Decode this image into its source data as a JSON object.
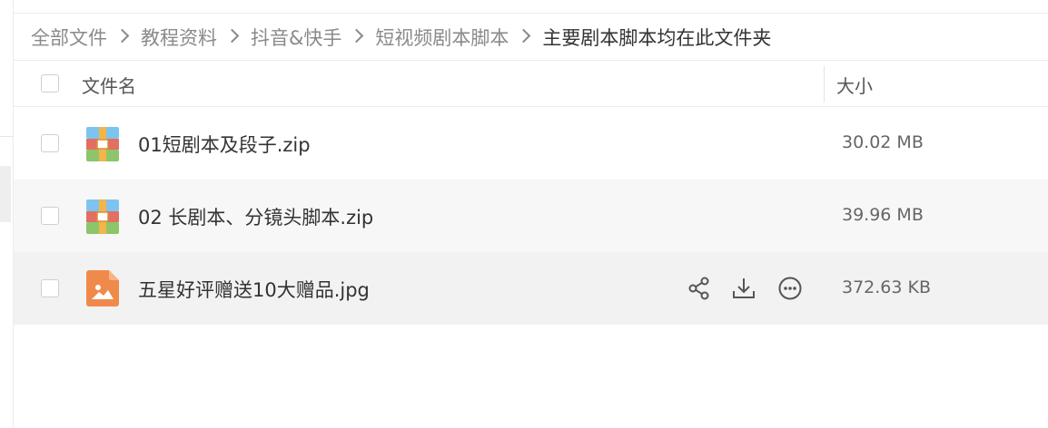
{
  "breadcrumb": {
    "items": [
      "全部文件",
      "教程资料",
      "抖音&快手",
      "短视频剧本脚本"
    ],
    "current": "主要剧本脚本均在此文件夹"
  },
  "columns": {
    "name": "文件名",
    "size": "大小"
  },
  "files": [
    {
      "name": "01短剧本及段子.zip",
      "size": "30.02 MB",
      "icon": "archive-icon"
    },
    {
      "name": "02 长剧本、分镜头脚本.zip",
      "size": "39.96 MB",
      "icon": "archive-icon"
    },
    {
      "name": "五星好评赠送10大赠品.jpg",
      "size": "372.63 KB",
      "icon": "image-file-icon"
    }
  ],
  "row_actions": [
    "share-icon",
    "download-icon",
    "more-icon"
  ],
  "colors": {
    "archive_blue": "#7cc4ef",
    "archive_red": "#e26f61",
    "archive_green": "#8cc56a",
    "archive_strap": "#f2b54a",
    "image_orange": "#f08a4b",
    "row_hover": "#f2f2f2"
  }
}
